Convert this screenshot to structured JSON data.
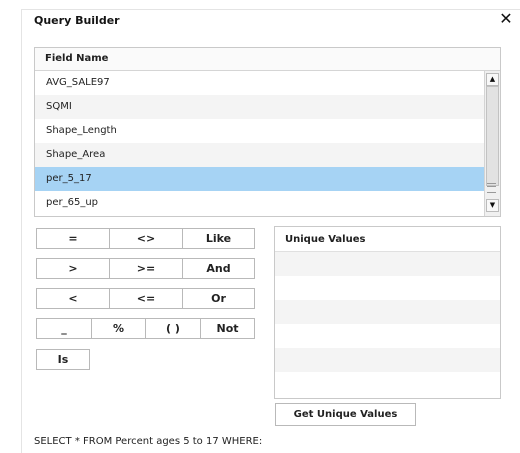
{
  "dialog": {
    "title": "Query Builder",
    "close_glyph": "✕",
    "close_icon": "close-icon"
  },
  "field_list": {
    "header": "Field Name",
    "items": [
      {
        "label": "AVG_SALE97",
        "selected": false
      },
      {
        "label": "SQMI",
        "selected": false
      },
      {
        "label": "Shape_Length",
        "selected": false
      },
      {
        "label": "Shape_Area",
        "selected": false
      },
      {
        "label": "per_5_17",
        "selected": true
      },
      {
        "label": "per_65_up",
        "selected": false
      }
    ],
    "scroll_up_glyph": "▲",
    "scroll_down_glyph": "▼"
  },
  "operators": {
    "row1": [
      "=",
      "<>",
      "Like"
    ],
    "row2": [
      ">",
      ">=",
      "And"
    ],
    "row3": [
      "<",
      "<=",
      "Or"
    ],
    "row4": [
      "_",
      "%",
      "( )",
      "Not"
    ],
    "row5": [
      "Is"
    ]
  },
  "unique_values": {
    "header": "Unique Values",
    "button_label": "Get Unique Values"
  },
  "query": {
    "text": "SELECT * FROM Percent ages 5 to 17 WHERE:"
  },
  "colors": {
    "selection": "#a6d3f4",
    "row_alt": "#f4f4f4",
    "border": "#b9b9b9"
  }
}
